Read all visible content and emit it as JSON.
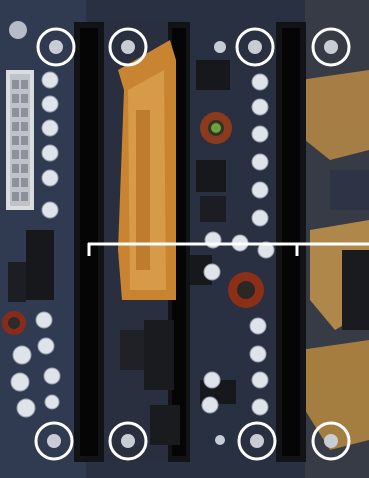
{
  "image": {
    "kind": "photo",
    "subject": "motherboard-section",
    "colors": {
      "board": "#2a3142",
      "slot": "#15161a",
      "copper": "#c98a35",
      "gold": "#d7aa5a",
      "capacitor": "#dfe3ea",
      "chip": "#1a1b1f",
      "marker": "#ffffff"
    },
    "markers": {
      "circle_count": 8,
      "bracket_line": true
    }
  }
}
